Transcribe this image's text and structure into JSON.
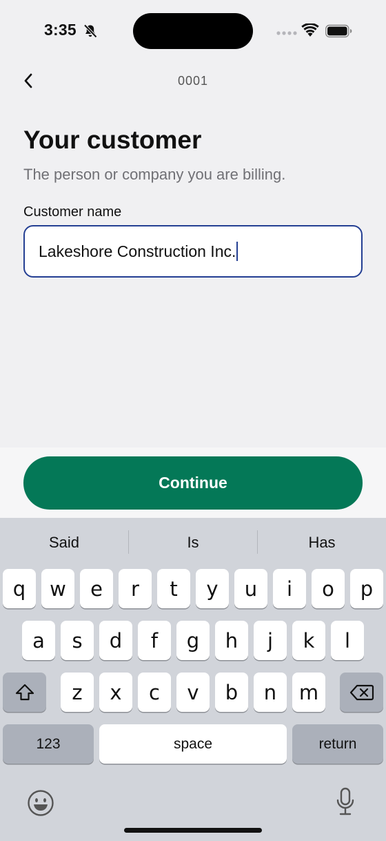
{
  "status_bar": {
    "time": "3:35",
    "icons": [
      "bell-slash-icon",
      "cellular-signal-icon",
      "wifi-icon",
      "battery-icon"
    ]
  },
  "nav": {
    "back_icon": "chevron-left-icon",
    "title": "0001"
  },
  "content": {
    "title": "Your customer",
    "subtitle": "The person or company you are billing.",
    "field_label": "Customer name",
    "field_value": "Lakeshore Construction Inc."
  },
  "actions": {
    "continue_label": "Continue"
  },
  "keyboard": {
    "suggestions": [
      "Said",
      "Is",
      "Has"
    ],
    "row1": [
      "q",
      "w",
      "e",
      "r",
      "t",
      "y",
      "u",
      "i",
      "o",
      "p"
    ],
    "row2": [
      "a",
      "s",
      "d",
      "f",
      "g",
      "h",
      "j",
      "k",
      "l"
    ],
    "row3": [
      "z",
      "x",
      "c",
      "v",
      "b",
      "n",
      "m"
    ],
    "numbers_label": "123",
    "space_label": "space",
    "return_label": "return",
    "shift_icon": "shift-icon",
    "delete_icon": "delete-backspace-icon",
    "emoji_icon": "emoji-icon",
    "mic_icon": "microphone-icon"
  },
  "colors": {
    "accent_green": "#047857",
    "focus_blue": "#243f93",
    "background": "#f0f0f2",
    "keyboard_bg": "#d1d4da"
  }
}
